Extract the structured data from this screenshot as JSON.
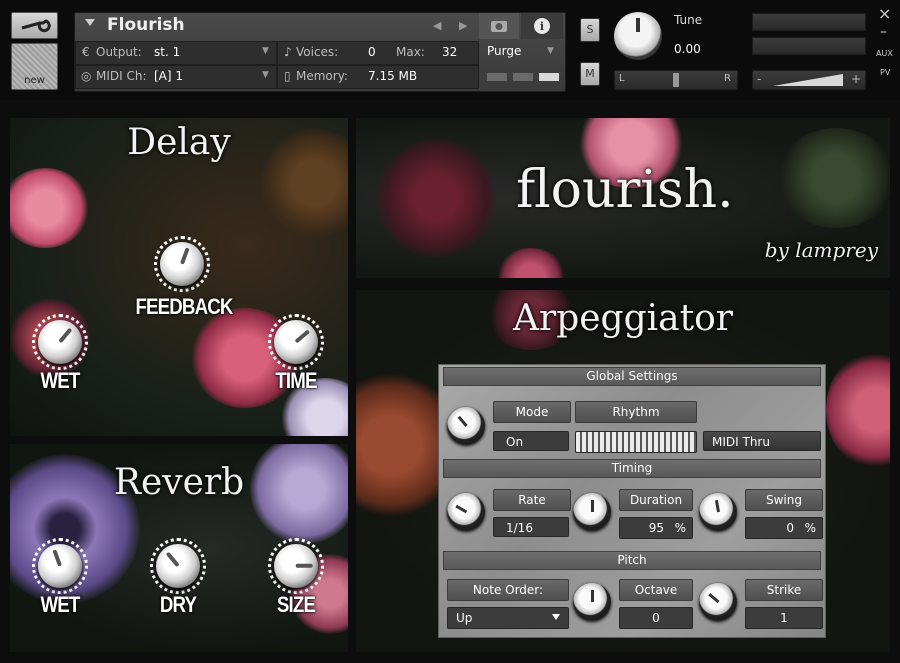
{
  "instrument": {
    "name": "Flourish",
    "output_label": "Output:",
    "output_value": "st. 1",
    "voices_label": "Voices:",
    "voices_value": "0",
    "max_label": "Max:",
    "max_value": "32",
    "purge_label": "Purge",
    "midi_label": "MIDI Ch:",
    "midi_value": "[A]  1",
    "memory_label": "Memory:",
    "memory_value": "7.15 MB",
    "new_label": "new",
    "solo_label": "S",
    "mute_label": "M",
    "tune_label": "Tune",
    "tune_value": "0.00",
    "pan_left": "L",
    "pan_right": "R",
    "aux_label": "AUX",
    "pv_label": "PV",
    "vol_minus": "-",
    "vol_plus": "+",
    "close_glyph": "×",
    "minimize_glyph": "–"
  },
  "delay": {
    "title": "Delay",
    "knobs": [
      {
        "label": "FEEDBACK"
      },
      {
        "label": "WET"
      },
      {
        "label": "TIME"
      }
    ]
  },
  "reverb": {
    "title": "Reverb",
    "knobs": [
      {
        "label": "WET"
      },
      {
        "label": "DRY"
      },
      {
        "label": "SIZE"
      }
    ]
  },
  "banner": {
    "title": "flourish.",
    "byline": "by lamprey"
  },
  "arpeggiator": {
    "title": "Arpeggiator",
    "global_header": "Global Settings",
    "mode_label": "Mode",
    "mode_value": "On",
    "rhythm_label": "Rhythm",
    "midi_thru_label": "MIDI Thru",
    "timing_header": "Timing",
    "rate_label": "Rate",
    "rate_value": "1/16",
    "duration_label": "Duration",
    "duration_value": "95",
    "duration_unit": "%",
    "swing_label": "Swing",
    "swing_value": "0",
    "swing_unit": "%",
    "pitch_header": "Pitch",
    "note_order_label": "Note Order:",
    "note_order_value": "Up",
    "octave_label": "Octave",
    "octave_value": "0",
    "strike_label": "Strike",
    "strike_value": "1"
  },
  "colors": {
    "background": "#0d0d0d",
    "panel_gray": "#9a9a9a",
    "title_white": "#f2f2f2"
  }
}
